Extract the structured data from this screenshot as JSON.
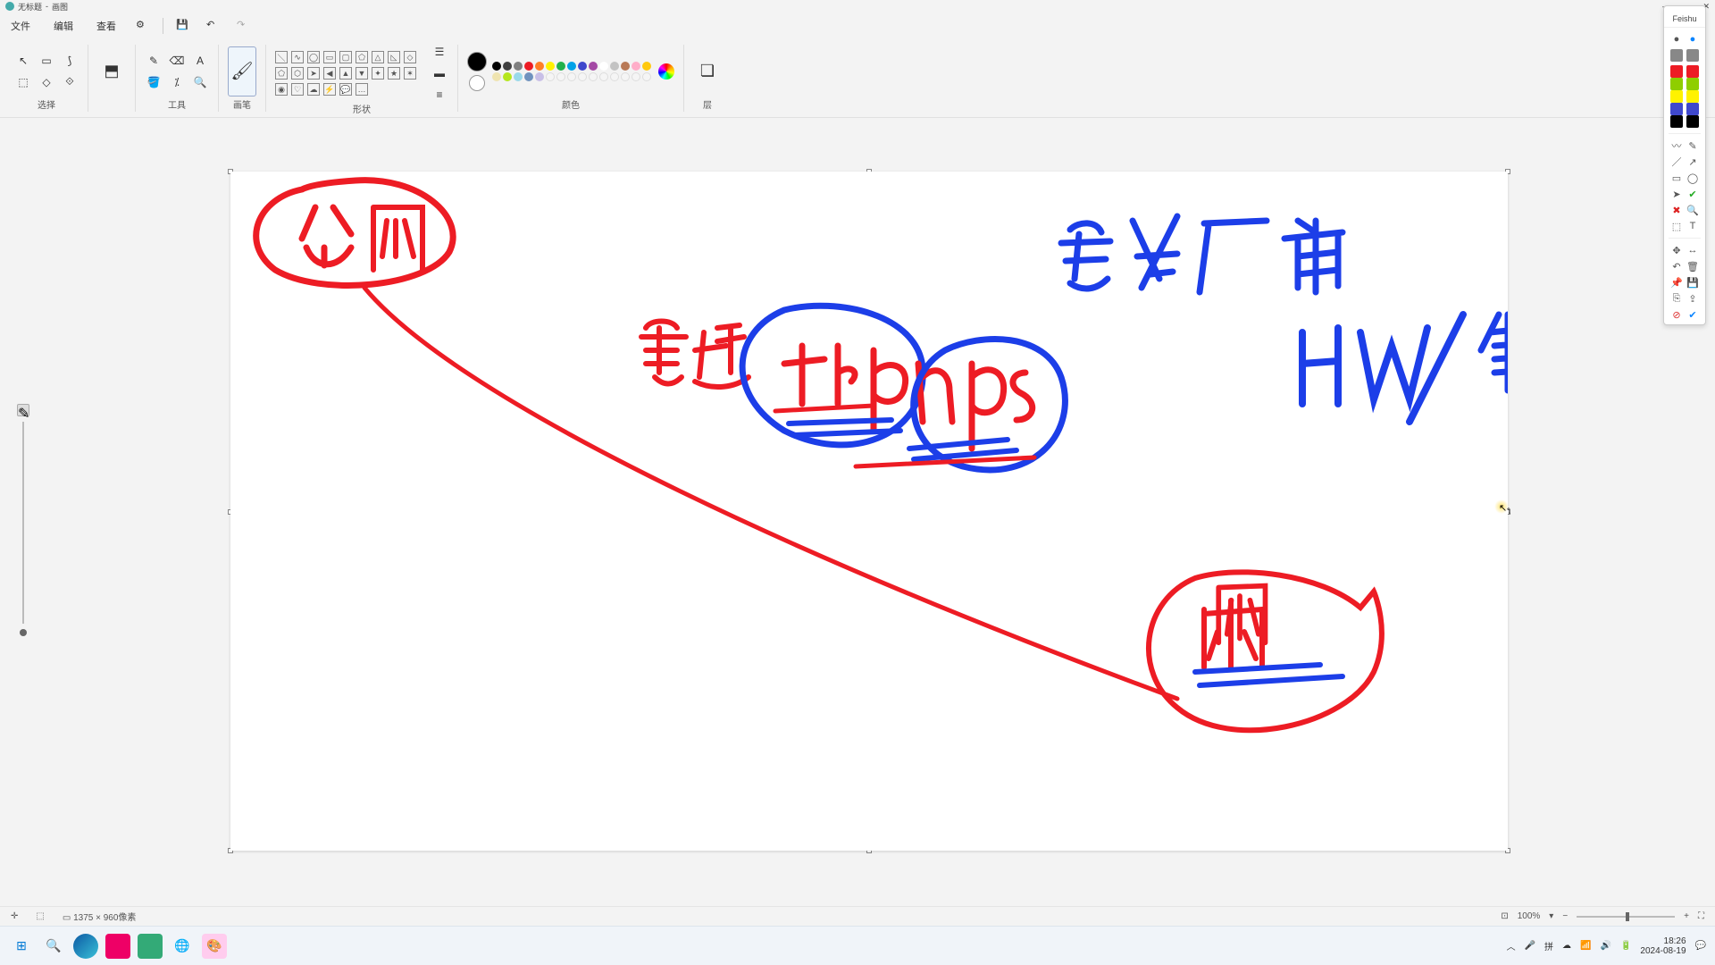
{
  "title": {
    "doc": "无标题",
    "app": "画图"
  },
  "menu": {
    "file": "文件",
    "edit": "编辑",
    "view": "查看"
  },
  "ribbon": {
    "groups": {
      "select": "选择",
      "tools": "工具",
      "brush": "画笔",
      "shapes": "形状",
      "colors": "颜色",
      "layers": "层"
    }
  },
  "palette_colors_row1": [
    "#000000",
    "#404040",
    "#808080",
    "#ed1c24",
    "#ff7f27",
    "#fff200",
    "#22b14c",
    "#00a2e8",
    "#3f48cc",
    "#a349a4"
  ],
  "palette_colors_row2": [
    "#ffffff",
    "#c3c3c3",
    "#b97a57",
    "#ffaec9",
    "#ffc90e",
    "#efe4b0",
    "#b5e61d",
    "#99d9ea",
    "#7092be",
    "#c8bfe7"
  ],
  "palette_colors_row3": [
    "#f5f5f5",
    "#f5f5f5",
    "#f5f5f5",
    "#f5f5f5",
    "#f5f5f5",
    "#f5f5f5",
    "#f5f5f5",
    "#f5f5f5",
    "#f5f5f5",
    "#f5f5f5"
  ],
  "current_color1": "#000000",
  "current_color2": "#ffffff",
  "float": {
    "title": "Feishu",
    "colors": [
      "#ed1c24",
      "#ed1c24",
      "#8fce00",
      "#8fce00",
      "#fff200",
      "#fff200",
      "#3f48cc",
      "#3f48cc",
      "#000000",
      "#000000"
    ]
  },
  "status": {
    "pos_icon": "✛",
    "sel_icon": "⬚",
    "size": "1375 × 960像素",
    "zoom": "100%"
  },
  "taskbar": {
    "time": "18:26",
    "date": "2024-08-19",
    "ime": "拼"
  },
  "drawing": {
    "red": "#ed1c24",
    "blue": "#1c3ee8",
    "labels": {
      "gongwang": "公网",
      "chuantou": "穿透",
      "frp": "frp",
      "nps": "nps",
      "anquan": "安全厂商",
      "hw": "HW",
      "dengbao": "等保",
      "neiwang": "内网"
    }
  }
}
